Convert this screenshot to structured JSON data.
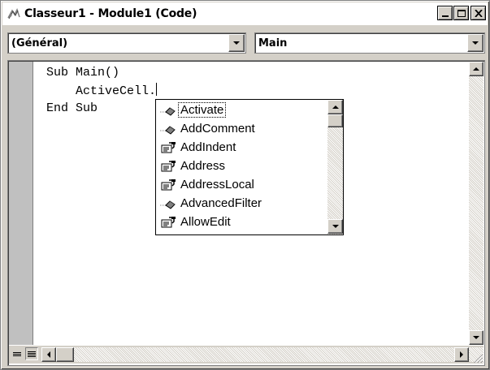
{
  "window": {
    "title": "Classeur1 - Module1 (Code)",
    "buttons": {
      "minimize": "minimize-icon",
      "maximize": "maximize-icon",
      "close": "close-icon"
    }
  },
  "toolbar": {
    "object_combo": {
      "value": "(Général)"
    },
    "procedure_combo": {
      "value": "Main"
    }
  },
  "code": {
    "lines": [
      "Sub Main()",
      "    ActiveCell.",
      "End Sub"
    ]
  },
  "autocomplete": {
    "selected_index": 0,
    "items": [
      {
        "label": "Activate",
        "icon": "method-icon"
      },
      {
        "label": "AddComment",
        "icon": "method-icon"
      },
      {
        "label": "AddIndent",
        "icon": "property-icon"
      },
      {
        "label": "Address",
        "icon": "property-icon"
      },
      {
        "label": "AddressLocal",
        "icon": "property-icon"
      },
      {
        "label": "AdvancedFilter",
        "icon": "method-icon"
      },
      {
        "label": "AllowEdit",
        "icon": "property-icon"
      }
    ]
  },
  "colors": {
    "window_face": "#d4d0c8",
    "editor_bg": "#ffffff",
    "margin": "#c0c0c0"
  }
}
